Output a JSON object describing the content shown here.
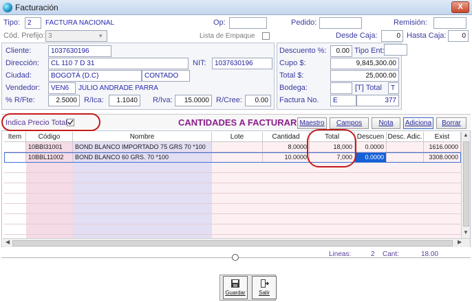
{
  "window": {
    "title": "Facturación",
    "close_label": "X"
  },
  "header": {
    "tipo_label": "Tipo:",
    "tipo_value": "2",
    "tipo_desc": "FACTURA NACIONAL",
    "op_label": "Op:",
    "op_value": "",
    "pedido_label": "Pedido:",
    "pedido_value": "",
    "remision_label": "Remisión:",
    "remision_value": "",
    "prefijo_label": "Cód. Prefijo:",
    "prefijo_value": "3",
    "lista_label": "Lista de Empaque",
    "desde_label": "Desde Caja:",
    "desde_value": "0",
    "hasta_label": "Hasta Caja:",
    "hasta_value": "0"
  },
  "client": {
    "cliente_label": "Cliente:",
    "cliente_value": "1037630196",
    "direccion_label": "Dirección:",
    "direccion_value": "CL 110 7 D 31",
    "nit_label": "NIT:",
    "nit_value": "1037630196",
    "ciudad_label": "Ciudad:",
    "ciudad_value": "BOGOTÁ (D.C)",
    "contado_value": "CONTADO",
    "vendedor_label": "Vendedor:",
    "vendedor_code": "VEN6",
    "vendedor_name": "JULIO ANDRADE PARRA",
    "rfte_label": "% R/Fte:",
    "rfte_value": "2.5000",
    "rica_label": "R/Ica:",
    "rica_value": "1.1040",
    "riva_label": "R/Iva:",
    "riva_value": "15.0000",
    "rcree_label": "R/Cree:",
    "rcree_value": "0.00"
  },
  "totals": {
    "descuento_label": "Descuento %:",
    "descuento_value": "0.00",
    "tipoent_label": "Tipo Ent:",
    "tipoent_value": "",
    "cupo_label": "Cupo $:",
    "cupo_value": "9,845,300.00",
    "total_label": "Total $:",
    "total_value": "25,000.00",
    "bodega_label": "Bodega:",
    "bodega_value": "",
    "ttotal_label": "[T] Total",
    "ttotal_value": "T",
    "factura_label": "Factura No.",
    "factura_prefix": "E",
    "factura_value": "377"
  },
  "items_bar": {
    "indica_label": "Indica Precio Total",
    "title": "CANTIDADES A FACTURAR",
    "buttons": [
      "Maestro",
      "Campos",
      "Nota",
      "Adiciona",
      "Borrar"
    ]
  },
  "grid": {
    "columns": [
      "Item",
      "Código",
      "Nombre",
      "Lote",
      "Cantidad",
      "Total",
      "Descuen",
      "Desc. Adic.",
      "Exist"
    ],
    "rows": [
      {
        "item": "",
        "codigo": "10BBI31001",
        "nombre": "BOND BLANCO IMPORTADO 75 GRS 70 *100",
        "lote": "",
        "cantidad": "8.0000",
        "total": "18,000",
        "descuento": "0.0000",
        "desc_adic": "",
        "exist": "1616.0000"
      },
      {
        "item": "",
        "codigo": "10BBL11002",
        "nombre": "BOND BLANCO 60 GRS. 70 *100",
        "lote": "",
        "cantidad": "10.0000",
        "total": "7,000",
        "descuento": "0.0000",
        "desc_adic": "",
        "exist": "3308.0000"
      }
    ]
  },
  "status": {
    "lineas_label": "Lineas:",
    "lineas_value": "2",
    "cant_label": "Cant:",
    "cant_value": "18.00"
  },
  "toolbar": {
    "guardar_label": "Guardar",
    "salir_label": "Salir"
  },
  "colors": {
    "accent": "#3a3aa0",
    "title_accent": "#8b1e8b",
    "annotation": "#c61a1a",
    "selected_cell": "#1560d6"
  }
}
